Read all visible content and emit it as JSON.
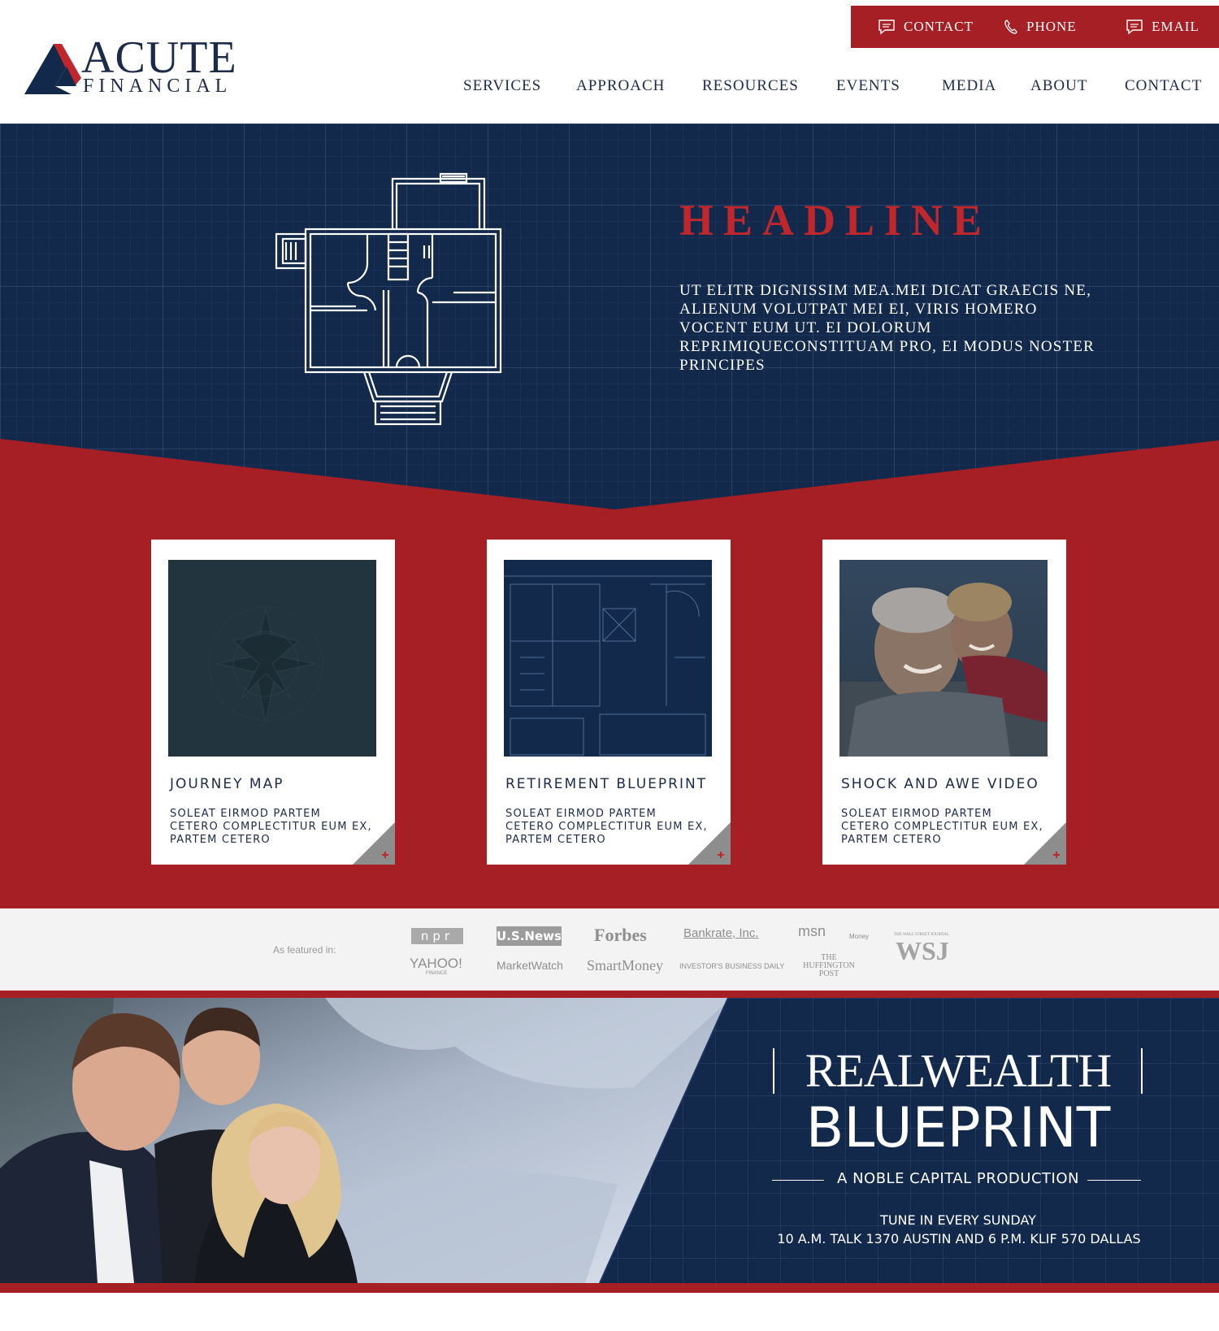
{
  "brand": {
    "name_line1": "ACUTE",
    "name_line2": "FINANCIAL",
    "colors": {
      "navy": "#13294b",
      "red": "#a51f24",
      "headline_red": "#c0272d"
    }
  },
  "utility": {
    "items": [
      {
        "label": "CONTACT",
        "icon": "chat-icon"
      },
      {
        "label": "PHONE",
        "icon": "phone-icon"
      },
      {
        "label": "EMAIL",
        "icon": "chat-icon"
      }
    ]
  },
  "nav": {
    "items": [
      {
        "label": "SERVICES"
      },
      {
        "label": "APPROACH"
      },
      {
        "label": "RESOURCES"
      },
      {
        "label": "EVENTS"
      },
      {
        "label": "MEDIA"
      },
      {
        "label": "ABOUT"
      },
      {
        "label": "CONTACT"
      }
    ]
  },
  "hero": {
    "headline": "HEADLINE",
    "body": "UT ELITR DIGNISSIM MEA.MEI DICAT GRAECIS NE, ALIENUM VOLUTPAT MEI EI, VIRIS HOMERO VOCENT EUM UT. EI DOLORUM REPRIMIQUECONSTITUAM PRO, EI MODUS NOSTER PRINCIPES"
  },
  "cards": [
    {
      "title": "JOURNEY MAP",
      "text": "SOLEAT EIRMOD PARTEM CETERO COMPLECTITUR EUM EX, PARTEM CETERO",
      "corner_icon": "plus-icon"
    },
    {
      "title": "RETIREMENT BLUEPRINT",
      "text": "SOLEAT EIRMOD PARTEM CETERO COMPLECTITUR EUM EX, PARTEM CETERO",
      "corner_icon": "plus-icon"
    },
    {
      "title": "SHOCK AND AWE VIDEO",
      "text": "SOLEAT EIRMOD PARTEM CETERO COMPLECTITUR EUM EX, PARTEM CETERO",
      "corner_icon": "plus-icon"
    }
  ],
  "featured": {
    "label": "As featured in:",
    "logos": {
      "npr": "npr",
      "usnews": "U.S.News",
      "forbes": "Forbes",
      "bankrate": "Bankrate, Inc.",
      "msn": "msn",
      "msn_sub": "Money",
      "wsj_sub": "THE WALL STREET JOURNAL",
      "wsj": "WSJ",
      "yahoo": "YAHOO!",
      "yahoo_sub": "FINANCE",
      "marketwatch": "MarketWatch",
      "smartmoney": "SmartMoney",
      "ibd": "INVESTOR'S BUSINESS DAILY",
      "huffpost": "THE HUFFINGTON POST"
    }
  },
  "show": {
    "title_line1": "REALWEALTH",
    "title_line2": "BLUEPRINT",
    "subtitle": "A NOBLE CAPITAL PRODUCTION",
    "tune_in": "TUNE IN EVERY SUNDAY",
    "times": "10 A.M. TALK 1370 AUSTIN  AND 6 P.M. KLIF 570 DALLAS"
  }
}
